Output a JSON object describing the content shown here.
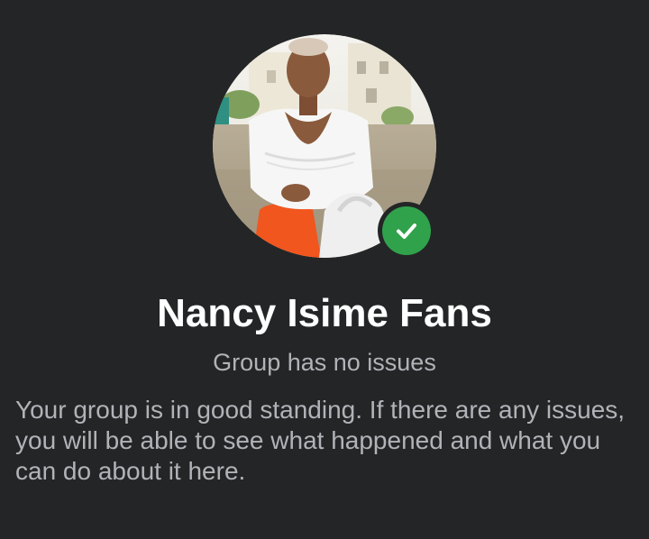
{
  "group": {
    "name": "Nancy Isime Fans",
    "status": "Group has no issues",
    "description": "Your group is in good standing. If there are any issues, you will be able to see what happened and what you can do about it here."
  },
  "avatar": {
    "icon": "group-profile-photo"
  },
  "badge": {
    "icon": "check-icon",
    "color": "#31a24c"
  },
  "colors": {
    "background": "#242526",
    "title": "#ffffff",
    "secondary_text": "#b0b3b8"
  }
}
